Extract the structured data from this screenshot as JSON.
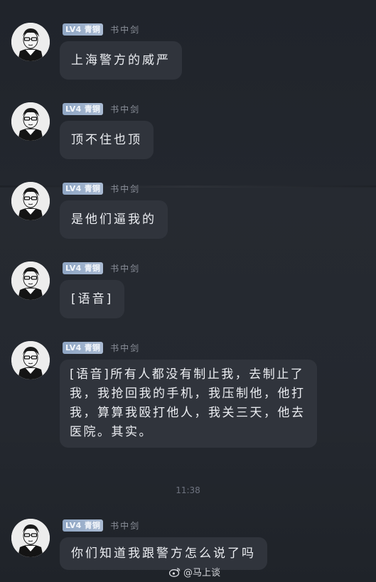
{
  "user": {
    "level": "LV4",
    "rank": "青铜",
    "nickname": "书中剑"
  },
  "messages": [
    {
      "text": "上海警方的威严"
    },
    {
      "text": "顶不住也顶"
    },
    {
      "text": "是他们逼我的"
    },
    {
      "text": "[语音]"
    },
    {
      "text": "[语音]所有人都没有制止我，去制止了我，我抢回我的手机，我压制他，他打我，算算我殴打他人，我关三天，他去医院。其实。"
    },
    {
      "text": "你们知道我跟警方怎么说了吗"
    }
  ],
  "timestamp": "11:38",
  "watermark": "@马上谈",
  "icons": {
    "avatar": "user-avatar-sketch",
    "watermark": "weibo-icon"
  }
}
